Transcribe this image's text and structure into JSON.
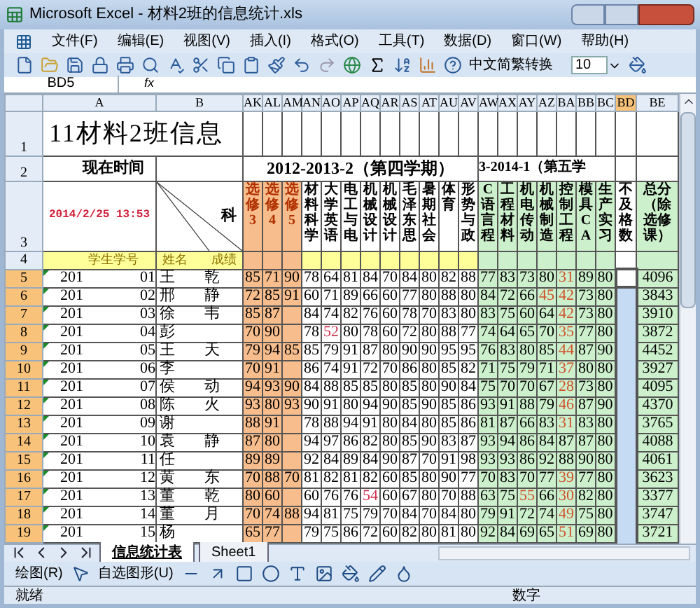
{
  "window": {
    "title": "Microsoft Excel - 材料2班的信息统计.xls"
  },
  "menu": [
    "文件(F)",
    "编辑(E)",
    "视图(V)",
    "插入(I)",
    "格式(O)",
    "工具(T)",
    "数据(D)",
    "窗口(W)",
    "帮助(H)"
  ],
  "toolbar": {
    "convert": "中文简繁转换",
    "font_size": "10"
  },
  "formula_bar": {
    "name_box": "BD5",
    "fx": "fx"
  },
  "columns": [
    {
      "label": "A",
      "selected": false
    },
    {
      "label": "B",
      "selected": false
    },
    {
      "label": "AK",
      "selected": false
    },
    {
      "label": "AL",
      "selected": false
    },
    {
      "label": "AM",
      "selected": false
    },
    {
      "label": "AN",
      "selected": false
    },
    {
      "label": "AO",
      "selected": false
    },
    {
      "label": "AP",
      "selected": false
    },
    {
      "label": "AQ",
      "selected": false
    },
    {
      "label": "AR",
      "selected": false
    },
    {
      "label": "AS",
      "selected": false
    },
    {
      "label": "AT",
      "selected": false
    },
    {
      "label": "AU",
      "selected": false
    },
    {
      "label": "AV",
      "selected": false
    },
    {
      "label": "AW",
      "selected": false
    },
    {
      "label": "AX",
      "selected": false
    },
    {
      "label": "AY",
      "selected": false
    },
    {
      "label": "AZ",
      "selected": false
    },
    {
      "label": "BA",
      "selected": false
    },
    {
      "label": "BB",
      "selected": false
    },
    {
      "label": "BC",
      "selected": false
    },
    {
      "label": "BD",
      "selected": true
    },
    {
      "label": "BE",
      "selected": false
    }
  ],
  "header_rows": [
    "1",
    "2",
    "3",
    "4"
  ],
  "sheet": {
    "title": "11材料2班信息",
    "time_label": "现在时间",
    "time": "2014/2/25 13:53",
    "subject_corner": "科",
    "id_header": "学生学号",
    "name_header": "姓名",
    "score_header": "成绩",
    "term4": "2012-2013-2（第四学期）",
    "term5": "3-2014-1（第五学",
    "subjects": [
      {
        "label": "选修3",
        "kind": "elective"
      },
      {
        "label": "选修4",
        "kind": "elective"
      },
      {
        "label": "选修5",
        "kind": "elective"
      },
      {
        "label": "材料科学",
        "kind": "term4"
      },
      {
        "label": "大学英语",
        "kind": "term4"
      },
      {
        "label": "电工与电",
        "kind": "term4"
      },
      {
        "label": "机械设计",
        "kind": "term4"
      },
      {
        "label": "机械设计",
        "kind": "term4"
      },
      {
        "label": "毛泽东思",
        "kind": "term4"
      },
      {
        "label": "暑期社会",
        "kind": "term4"
      },
      {
        "label": "体育",
        "kind": "term4"
      },
      {
        "label": "形势与政",
        "kind": "term4"
      },
      {
        "label": "C语言程",
        "kind": "term5"
      },
      {
        "label": "工程材料",
        "kind": "term5"
      },
      {
        "label": "机电传动",
        "kind": "term5"
      },
      {
        "label": "机械制造",
        "kind": "term5"
      },
      {
        "label": "控制工程",
        "kind": "term5"
      },
      {
        "label": "模具CA",
        "kind": "term5"
      },
      {
        "label": "生产实习",
        "kind": "term5"
      },
      {
        "label": "不及格数",
        "kind": "fail"
      },
      {
        "label": "总分（除选修课）",
        "kind": "total"
      }
    ]
  },
  "rows": [
    {
      "num": "5",
      "selected": true,
      "active": true,
      "id": "201",
      "id_end": "01",
      "name": "王",
      "name_end": "乾",
      "electives": [
        "85",
        "71",
        "90"
      ],
      "term4": [
        "78",
        "64",
        "81",
        "84",
        "70",
        "84",
        "80",
        "82",
        "88"
      ],
      "term5": [
        "77",
        "83",
        "73",
        "80",
        "31",
        "89",
        "80"
      ],
      "total": "4096"
    },
    {
      "num": "6",
      "selected": true,
      "active": false,
      "id": "201",
      "id_end": "02",
      "name": "邢",
      "name_end": "静",
      "electives": [
        "72",
        "85",
        "91"
      ],
      "term4": [
        "60",
        "71",
        "89",
        "66",
        "60",
        "77",
        "80",
        "88",
        "80"
      ],
      "term5": [
        "84",
        "72",
        "66",
        "45",
        "42",
        "73",
        "80"
      ],
      "total": "3843"
    },
    {
      "num": "7",
      "selected": true,
      "active": false,
      "id": "201",
      "id_end": "03",
      "name": "徐",
      "name_end": "韦",
      "electives": [
        "85",
        "87"
      ],
      "term4": [
        "84",
        "74",
        "82",
        "76",
        "60",
        "78",
        "70",
        "83",
        "80"
      ],
      "term5": [
        "83",
        "75",
        "60",
        "64",
        "42",
        "73",
        "80"
      ],
      "total": "3910"
    },
    {
      "num": "8",
      "selected": true,
      "active": false,
      "id": "201",
      "id_end": "04",
      "name": "彭",
      "electives": [
        "70",
        "90"
      ],
      "term4": [
        "78",
        "52",
        "80",
        "78",
        "60",
        "72",
        "80",
        "88",
        "77"
      ],
      "term5": [
        "74",
        "64",
        "65",
        "70",
        "35",
        "77",
        "80"
      ],
      "total": "3872"
    },
    {
      "num": "9",
      "selected": true,
      "active": false,
      "id": "201",
      "id_end": "05",
      "name": "王",
      "name_end": "天",
      "electives": [
        "79",
        "94",
        "85"
      ],
      "term4": [
        "85",
        "79",
        "91",
        "87",
        "80",
        "90",
        "90",
        "95",
        "95"
      ],
      "term5": [
        "76",
        "83",
        "80",
        "85",
        "44",
        "87",
        "90"
      ],
      "total": "4452"
    },
    {
      "num": "10",
      "selected": true,
      "active": false,
      "id": "201",
      "id_end": "06",
      "name": "李",
      "electives": [
        "70",
        "91"
      ],
      "term4": [
        "86",
        "74",
        "91",
        "72",
        "70",
        "86",
        "80",
        "85",
        "82"
      ],
      "term5": [
        "71",
        "75",
        "79",
        "71",
        "37",
        "80",
        "80"
      ],
      "total": "3927"
    },
    {
      "num": "11",
      "selected": true,
      "active": false,
      "id": "201",
      "id_end": "07",
      "name": "侯",
      "name_end": "动",
      "electives": [
        "94",
        "93",
        "90"
      ],
      "term4": [
        "84",
        "88",
        "85",
        "85",
        "80",
        "85",
        "80",
        "90",
        "84"
      ],
      "term5": [
        "75",
        "70",
        "70",
        "67",
        "28",
        "73",
        "80"
      ],
      "total": "4095"
    },
    {
      "num": "12",
      "selected": true,
      "active": false,
      "id": "201",
      "id_end": "08",
      "name": "陈",
      "name_end": "火",
      "electives": [
        "93",
        "80",
        "93"
      ],
      "term4": [
        "90",
        "91",
        "80",
        "94",
        "90",
        "85",
        "90",
        "85",
        "86"
      ],
      "term5": [
        "93",
        "91",
        "88",
        "79",
        "46",
        "87",
        "90"
      ],
      "total": "4370"
    },
    {
      "num": "13",
      "selected": true,
      "active": false,
      "id": "201",
      "id_end": "09",
      "name": "谢",
      "electives": [
        "88",
        "91"
      ],
      "term4": [
        "78",
        "88",
        "94",
        "91",
        "80",
        "84",
        "80",
        "85",
        "86"
      ],
      "term5": [
        "81",
        "87",
        "66",
        "83",
        "31",
        "83",
        "80"
      ],
      "total": "3765"
    },
    {
      "num": "14",
      "selected": true,
      "active": false,
      "id": "201",
      "id_end": "10",
      "name": "袁",
      "name_end": "静",
      "electives": [
        "87",
        "80"
      ],
      "term4": [
        "94",
        "97",
        "86",
        "82",
        "80",
        "85",
        "90",
        "83",
        "87"
      ],
      "term5": [
        "93",
        "94",
        "86",
        "84",
        "87",
        "87",
        "80"
      ],
      "total": "4088"
    },
    {
      "num": "15",
      "selected": true,
      "active": false,
      "id": "201",
      "id_end": "11",
      "name": "任",
      "electives": [
        "89",
        "89"
      ],
      "term4": [
        "92",
        "84",
        "89",
        "84",
        "90",
        "87",
        "70",
        "91",
        "98"
      ],
      "term5": [
        "93",
        "93",
        "86",
        "92",
        "88",
        "90",
        "80"
      ],
      "total": "4061"
    },
    {
      "num": "16",
      "selected": true,
      "active": false,
      "id": "201",
      "id_end": "12",
      "name": "黄",
      "name_end": "东",
      "electives": [
        "70",
        "88",
        "70"
      ],
      "term4": [
        "81",
        "82",
        "81",
        "82",
        "60",
        "85",
        "80",
        "90",
        "77"
      ],
      "term5": [
        "70",
        "83",
        "70",
        "77",
        "39",
        "77",
        "80"
      ],
      "total": "3623"
    },
    {
      "num": "17",
      "selected": true,
      "active": false,
      "id": "201",
      "id_end": "13",
      "name": "董",
      "name_end": "乾",
      "electives": [
        "80",
        "60"
      ],
      "term4": [
        "60",
        "76",
        "76",
        "54",
        "60",
        "67",
        "80",
        "70",
        "88"
      ],
      "term5": [
        "63",
        "75",
        "55",
        "66",
        "30",
        "82",
        "80"
      ],
      "total": "3377"
    },
    {
      "num": "18",
      "selected": true,
      "active": false,
      "id": "201",
      "id_end": "14",
      "name": "董",
      "name_end": "月",
      "electives": [
        "70",
        "74",
        "88"
      ],
      "term4": [
        "94",
        "81",
        "75",
        "79",
        "70",
        "84",
        "70",
        "84",
        "80"
      ],
      "term5": [
        "79",
        "91",
        "72",
        "74",
        "49",
        "75",
        "80"
      ],
      "total": "3747"
    },
    {
      "num": "19",
      "selected": true,
      "active": false,
      "id": "201",
      "id_end": "15",
      "name": "杨",
      "electives": [
        "65",
        "77"
      ],
      "term4": [
        "79",
        "75",
        "86",
        "72",
        "60",
        "82",
        "80",
        "81",
        "80"
      ],
      "term5": [
        "92",
        "84",
        "69",
        "65",
        "51",
        "69",
        "80"
      ],
      "total": "3721"
    }
  ],
  "sheet_tabs": [
    {
      "label": "信息统计表",
      "selected": true
    },
    {
      "label": "Sheet1",
      "selected": false
    }
  ],
  "drawing_toolbar": {
    "draw": "绘图(R)",
    "autoshapes": "自选图形(U)"
  },
  "status_bar": {
    "state": "就绪",
    "mode": "数字"
  }
}
